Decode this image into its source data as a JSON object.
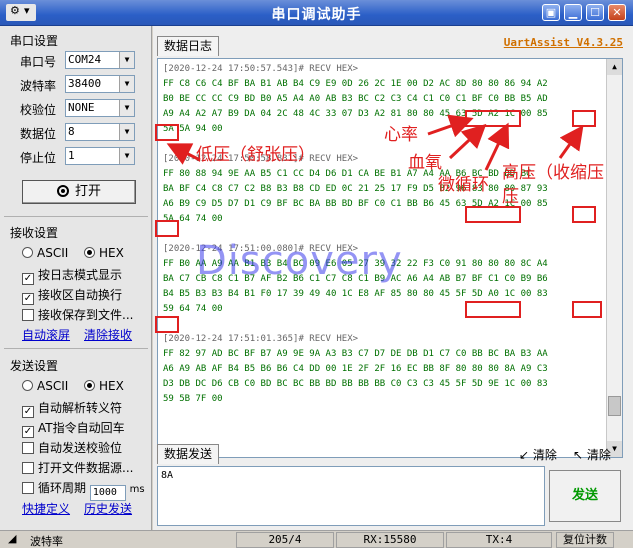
{
  "window": {
    "title": "串口调试助手",
    "brand": "UartAssist V4.3.25"
  },
  "serial": {
    "group_title": "串口设置",
    "port_label": "串口号",
    "port_value": "COM24",
    "baud_label": "波特率",
    "baud_value": "38400",
    "parity_label": "校验位",
    "parity_value": "NONE",
    "databits_label": "数据位",
    "databits_value": "8",
    "stopbits_label": "停止位",
    "stopbits_value": "1",
    "open_label": "打开"
  },
  "receive": {
    "group_title": "接收设置",
    "ascii": "ASCII",
    "hex": "HEX",
    "opt_log_mode": "按日志模式显示",
    "opt_auto_wrap": "接收区自动换行",
    "opt_save_file": "接收保存到文件...",
    "link_auto_scroll": "自动滚屏",
    "link_clear": "清除接收"
  },
  "send": {
    "group_title": "发送设置",
    "ascii": "ASCII",
    "hex": "HEX",
    "opt_escape": "自动解析转义符",
    "opt_at": "AT指令自动回车",
    "opt_checksum": "自动发送校验位",
    "opt_file": "打开文件数据源...",
    "opt_cycle": "循环周期",
    "cycle_value": "1000",
    "cycle_unit": "ms",
    "link_shortcut": "快捷定义",
    "link_history": "历史发送"
  },
  "tabs": {
    "log": "数据日志",
    "send": "数据发送"
  },
  "log_lines": [
    {
      "t": "hdr",
      "s": "[2020-12-24 17:50:57.543]# RECV HEX>"
    },
    {
      "t": "hex",
      "s": "FF C8 C6 C4 BF BA B1 AB B4 C9 E9 0D 26 2C 1E 00 D2 AC 8D 80 80 86 94 A2"
    },
    {
      "t": "hex",
      "s": "B0 BE CC CC C9 BD B0 A5 A4 A0 AB B3 BC C2 C3 C4 C1 C0 C1 BF C0 BB B5 AD"
    },
    {
      "t": "hex",
      "s": "A9 A4 A2 A7 B9 DA 04 2C 48 4C 33 07 D3 A2 81 80 80 45 63 5D A2 1C 00 85"
    },
    {
      "t": "hex",
      "s": "5A 5A 94 00"
    },
    {
      "t": "blank",
      "s": ""
    },
    {
      "t": "hdr",
      "s": "[2020-12-24 17:50:58.831]# RECV HEX>"
    },
    {
      "t": "hex",
      "s": "FF 80 88 94 9E AA B5 C1 CC D4 D6 D1 CA BE B1 A7 A4 AA B6 BC BD BD BC"
    },
    {
      "t": "hex",
      "s": "BA BF C4 C8 C7 C2 B8 B3 B8 CD ED 0C 21 25 17 F9 D5 B2 96 83 80 80 87 93"
    },
    {
      "t": "hex",
      "s": "A6 B9 C9 D5 D7 D1 C9 BF BC BA BB BD BF C0 C1 BB B6 45 63 5D A2 1C 00 85"
    },
    {
      "t": "hex",
      "s": "5A 64 74 00"
    },
    {
      "t": "blank",
      "s": ""
    },
    {
      "t": "hdr",
      "s": "[2020-12-24 17:51:00.080]# RECV HEX>"
    },
    {
      "t": "hex",
      "s": "FF B0 AA A9 AA B1 B3 B4 BC 09 E6 05 27 39 32 22 F3 C0 91 80 80 80 8C A4"
    },
    {
      "t": "hex",
      "s": "BA C7 CB C8 C1 B7 AF B2 B6 C1 C7 C8 C1 B9 AC A6 A4 AB B7 BF C1 C0 B9 B6"
    },
    {
      "t": "hex",
      "s": "B4 B5 B3 B3 B4 B1 F0 17 39 49 40 1C E8 AF 85 80 80 45 5F 5D A0 1C 00 83"
    },
    {
      "t": "hex",
      "s": "59 64 74 00"
    },
    {
      "t": "blank",
      "s": ""
    },
    {
      "t": "hdr",
      "s": "[2020-12-24 17:51:01.365]# RECV HEX>"
    },
    {
      "t": "hex",
      "s": "FF 82 97 AD BC BF B7 A9 9E 9A A3 B3 C7 D7 DE DB D1 C7 C0 BB BC BA B3 AA"
    },
    {
      "t": "hex",
      "s": "A6 A9 AB AF B4 B5 B6 B6 C4 DD 00 1E 2F 2F 16 EC BB 8F 80 80 80 8A A9 C3"
    },
    {
      "t": "hex",
      "s": "D3 DB DC D6 CB C0 BD BC BC BB BD BB BB BB C0 C3 C3 45 5F 5D 9E 1C 00 83"
    },
    {
      "t": "hex",
      "s": "59 5B 7F 00"
    }
  ],
  "watermark": "Discovery",
  "annotations": {
    "heart_rate": "心率",
    "blood_oxygen": "血氧",
    "microcirculation": "微循环",
    "high_pressure": "高压（收缩压",
    "high_pressure_cont": "压",
    "low_pressure": "低压（舒张压）"
  },
  "send_box": {
    "value": "8A",
    "send_label": "发送",
    "clear1": "清除",
    "clear2": "清除"
  },
  "status": {
    "label": "波特率",
    "count": "205/4",
    "rx": "RX:15580",
    "tx": "TX:4",
    "reset": "复位计数"
  },
  "colors": {
    "title_bar": "#2b5fc7",
    "annotation": "#e02020",
    "hex_text": "#007000",
    "watermark": "#3c3ceb"
  }
}
